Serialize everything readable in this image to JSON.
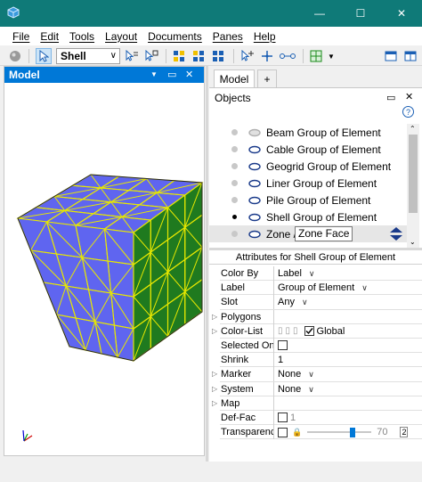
{
  "titlebar": {
    "minimize": "—",
    "maximize": "☐",
    "close": "✕"
  },
  "menu": [
    "File",
    "Edit",
    "Tools",
    "Layout",
    "Documents",
    "Panes",
    "Help"
  ],
  "toolbar": {
    "mode_combo": "Shell",
    "combo_arrow": "∨"
  },
  "left_pane": {
    "title": "Model",
    "btn_dropdown": "▼",
    "btn_float": "▭",
    "btn_close": "✕"
  },
  "right_pane": {
    "tabs": {
      "model": "Model",
      "add": "+"
    },
    "objects_title": "Objects",
    "objects": [
      {
        "label": "Beam Group of Element",
        "active": false,
        "eye": "off"
      },
      {
        "label": "Cable Group of Element",
        "active": false,
        "eye": "on"
      },
      {
        "label": "Geogrid Group of Element",
        "active": false,
        "eye": "on"
      },
      {
        "label": "Liner Group of Element",
        "active": false,
        "eye": "on"
      },
      {
        "label": "Pile Group of Element",
        "active": false,
        "eye": "on"
      },
      {
        "label": "Shell Group of Element",
        "active": true,
        "eye": "on"
      },
      {
        "label": "Zone /",
        "label2": "Zone Face",
        "active": false,
        "eye": "on",
        "selected": true
      }
    ],
    "attributes_title": "Attributes for Shell Group of Element",
    "attributes": [
      {
        "name": "Color By",
        "value": "Label",
        "dropdown": true
      },
      {
        "name": "Label",
        "value": "Group of Element",
        "dropdown": true
      },
      {
        "name": "Slot",
        "value": "Any",
        "dropdown": true
      },
      {
        "name": "Polygons",
        "value": "",
        "expand": true
      },
      {
        "name": "Color-List",
        "value": "Global",
        "expand": true,
        "checkbox": "checked"
      },
      {
        "name": "Selected Only",
        "value": "",
        "checkbox": "unchecked"
      },
      {
        "name": "Shrink",
        "value": "1"
      },
      {
        "name": "Marker",
        "value": "None",
        "dropdown": true,
        "expand": true
      },
      {
        "name": "System",
        "value": "None",
        "dropdown": true,
        "expand": true
      },
      {
        "name": "Map",
        "value": "",
        "expand": true
      },
      {
        "name": "Def-Fac",
        "value": "1",
        "checkbox": "unchecked",
        "grey": true
      },
      {
        "name": "Transparency",
        "value": "70",
        "checkbox": "unchecked",
        "slider": 0.7
      }
    ]
  },
  "colors": {
    "titlebar": "#0f7a78",
    "pane_header": "#0078d7",
    "cube_blue": "#5f65f0",
    "cube_green": "#1f7a1f",
    "edge_yellow": "#e8e800"
  }
}
